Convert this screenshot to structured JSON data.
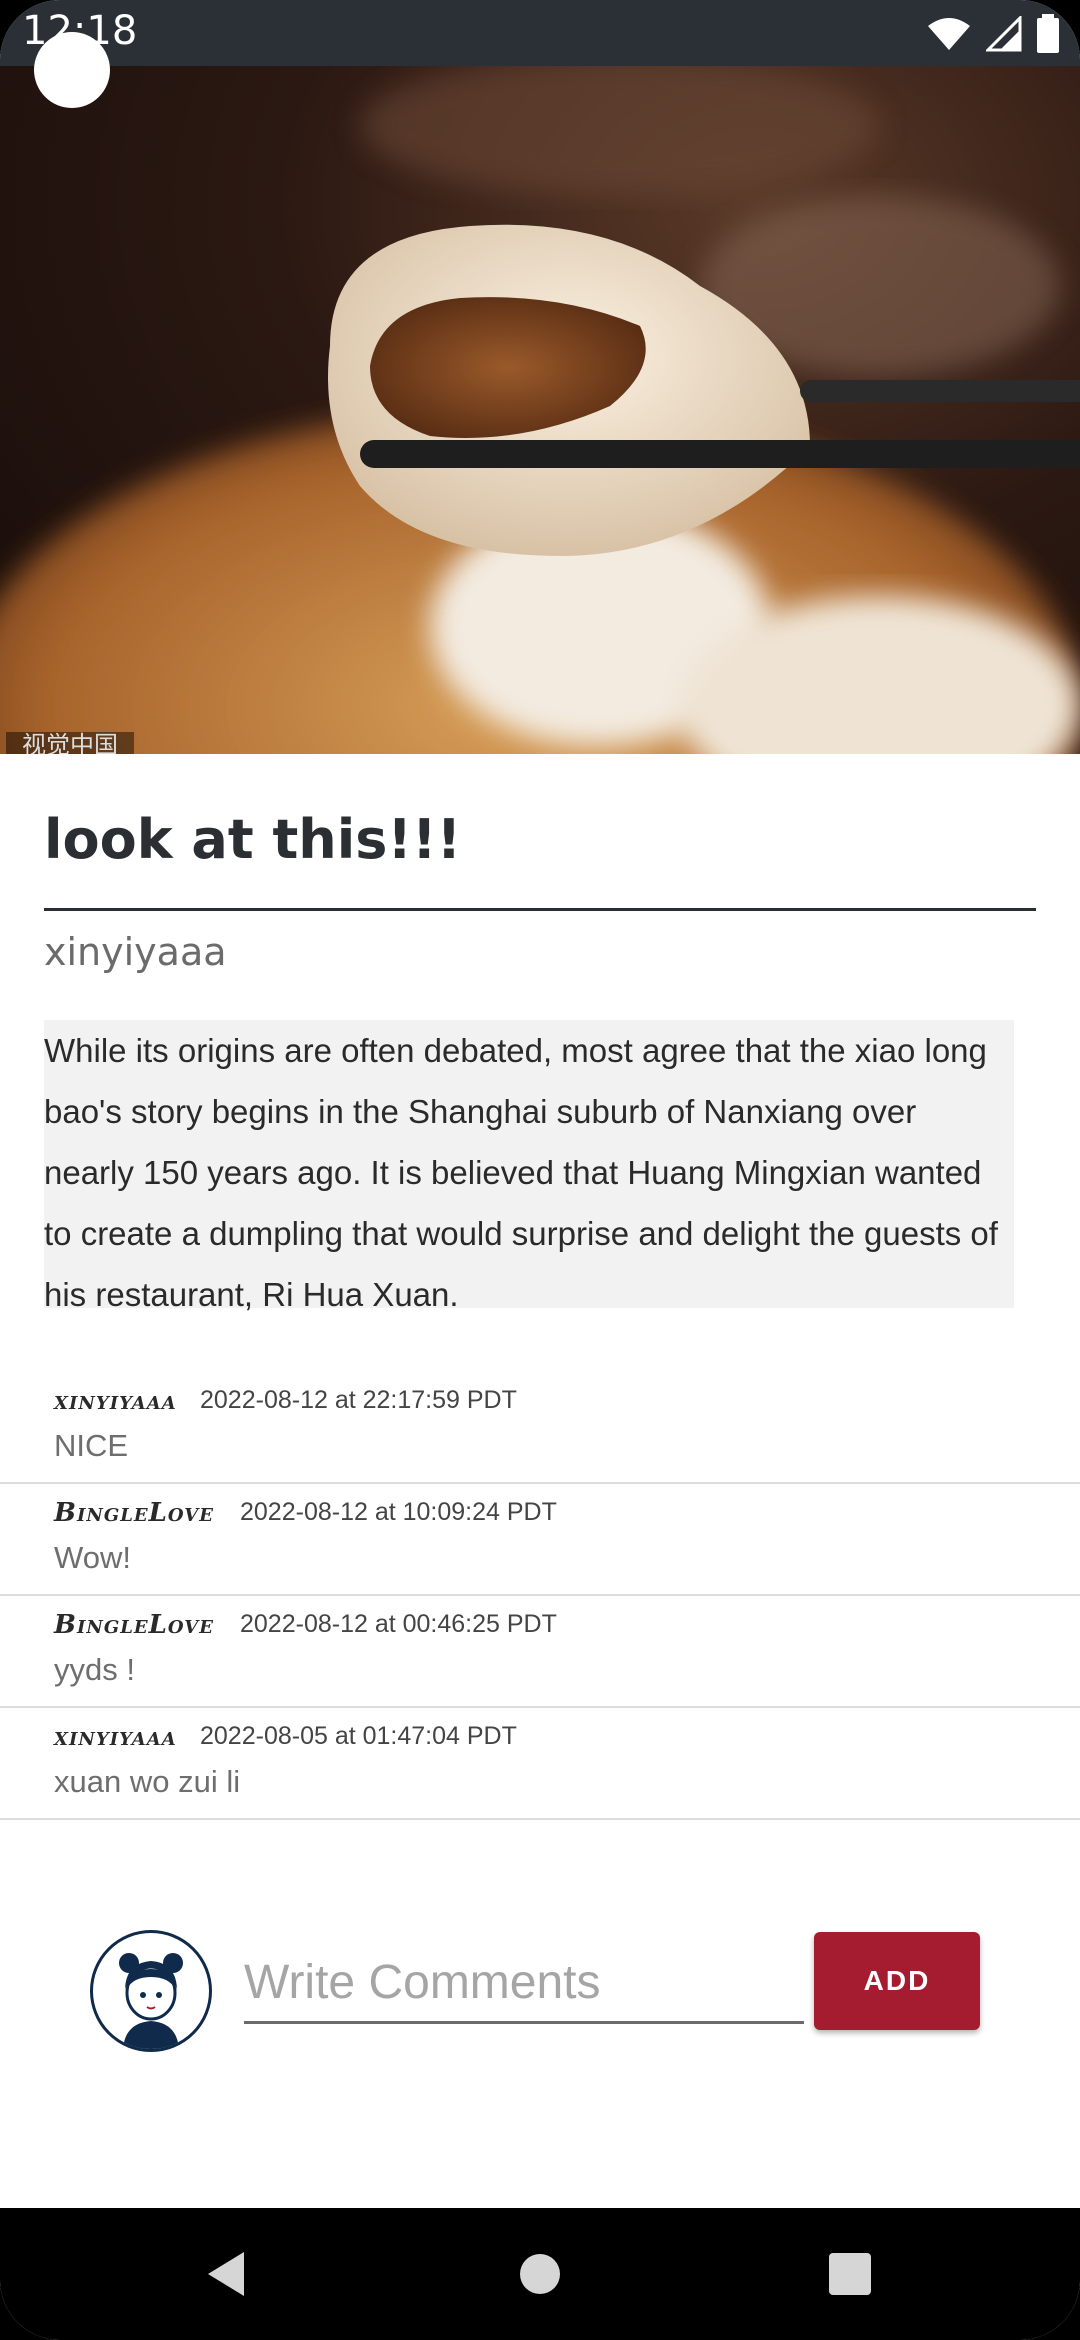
{
  "status_bar": {
    "time": "12:18",
    "icons": [
      "wifi-icon",
      "signal-icon",
      "battery-icon"
    ]
  },
  "post": {
    "image_caption": "视觉中国",
    "title": "look at this!!!",
    "author": "xinyiyaaa",
    "body": "While its origins are often debated, most agree that the xiao long bao's story begins in the Shanghai suburb of Nanxiang over nearly 150 years ago. It is believed that Huang Mingxian wanted to create a dumpling that would surprise and delight the guests of his restaurant, Ri Hua Xuan."
  },
  "comments": [
    {
      "user": "xinyiyaaa",
      "date": "2022-08-12 at 22:17:59 PDT",
      "text": "NICE"
    },
    {
      "user": "BingleLove",
      "date": "2022-08-12 at 10:09:24 PDT",
      "text": "Wow!"
    },
    {
      "user": "BingleLove",
      "date": "2022-08-12 at 00:46:25 PDT",
      "text": "yyds !"
    },
    {
      "user": "xinyiyaaa",
      "date": "2022-08-05 at 01:47:04 PDT",
      "text": "xuan wo zui li"
    }
  ],
  "compose": {
    "placeholder": "Write Comments",
    "value": "",
    "add_label": "ADD"
  },
  "colors": {
    "accent": "#a51c30",
    "title": "#2b2f33",
    "status_bar": "#2b3037"
  },
  "nav": [
    "back-icon",
    "home-icon",
    "recents-icon"
  ]
}
